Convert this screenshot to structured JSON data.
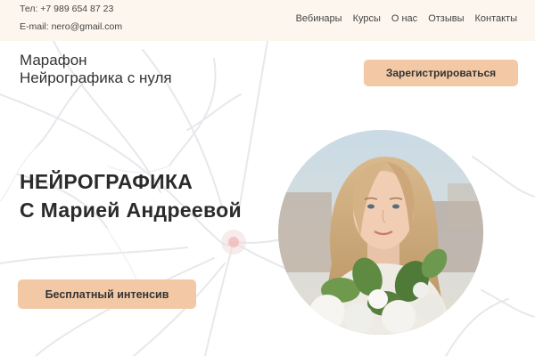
{
  "contacts": {
    "phone": "Тел: +7 989 654 87 23",
    "email": "E-mail: nero@gmail.com"
  },
  "nav": {
    "items": [
      "Вебинары",
      "Курсы",
      "О нас",
      "Отзывы",
      "Контакты"
    ]
  },
  "hero": {
    "marathon_line1": "Марафон",
    "marathon_line2": "Нейрографика с нуля",
    "register_label": "Зарегистрироваться",
    "headline_line1": "НЕЙРОГРАФИКА",
    "headline_line2": "С Марией Андреевой",
    "intensive_label": "Бесплатный интенсив"
  },
  "colors": {
    "topbar_bg": "#fdf6ee",
    "button_bg": "#f3c9a5",
    "text": "#2b2b2b"
  }
}
